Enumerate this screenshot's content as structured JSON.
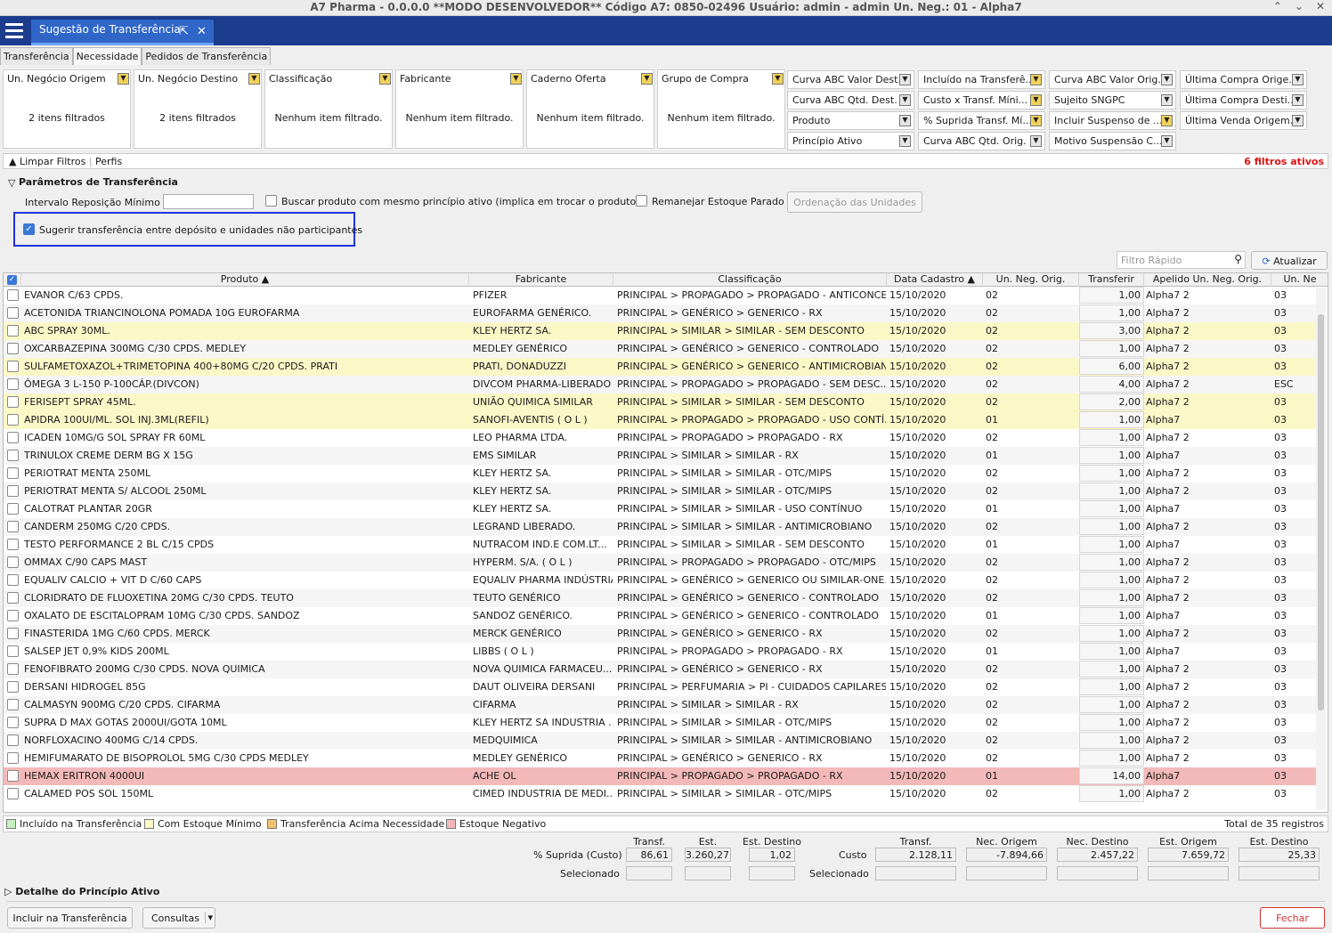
{
  "window": {
    "title": "A7 Pharma - 0.0.0.0   **MODO DESENVOLVEDOR**   Código A7: 0850-02496   Usuário: admin - admin   Un. Neg.: 01 - Alpha7",
    "controls": [
      "⌃",
      "⌄",
      "✕"
    ]
  },
  "tab": {
    "title": "Sugestão de Transferência"
  },
  "subtabs": [
    "Transferência",
    "Necessidade",
    "Pedidos de Transferência"
  ],
  "filters": [
    {
      "label": "Un. Negócio Origem",
      "value": "2 itens filtrados"
    },
    {
      "label": "Un. Negócio Destino",
      "value": "2 itens filtrados"
    },
    {
      "label": "Classificação",
      "value": "Nenhum item filtrado."
    },
    {
      "label": "Fabricante",
      "value": "Nenhum item filtrado."
    },
    {
      "label": "Caderno Oferta",
      "value": "Nenhum item filtrado."
    },
    {
      "label": "Grupo de Compra",
      "value": "Nenhum item filtrado."
    }
  ],
  "filter_cells": [
    [
      "Curva ABC Valor Dest.",
      "Incluído na Transferê...",
      "Curva ABC Valor Orig.",
      "Última Compra Orige..."
    ],
    [
      "Curva ABC Qtd. Dest.",
      "Custo x Transf. Míni...",
      "Sujeito SNGPC",
      "Última Compra Desti..."
    ],
    [
      "Produto",
      "% Suprida Transf. Mí...",
      "Incluir Suspenso de ...",
      "Última Venda Origem..."
    ],
    [
      "Princípio Ativo",
      "Curva ABC Qtd. Orig.",
      "Motivo Suspensão C...",
      ""
    ]
  ],
  "filter_bar": {
    "clear": "Limpar Filtros",
    "profiles": "Perfis",
    "active": "6 filtros ativos"
  },
  "params": {
    "title": "Parâmetros de Transferência",
    "interval_label": "Intervalo Reposição Mínimo",
    "interval_value": "",
    "same_principle": "Buscar produto com mesmo princípio ativo (implica em trocar o produto)",
    "relocate": "Remanejar Estoque Parado",
    "order_button": "Ordenação das Unidades",
    "suggest": "Sugerir transferência entre depósito e unidades não participantes"
  },
  "quick_filter": {
    "placeholder": "Filtro Rápido",
    "refresh": "Atualizar"
  },
  "columns": [
    "Produto ▲",
    "Fabricante",
    "Classificação",
    "Data Cadastro ▲",
    "Un. Neg. Orig.",
    "Transferir",
    "Apelido Un. Neg. Orig.",
    "Un. Ne"
  ],
  "rows": [
    {
      "p": "EVANOR C/63 CPDS.",
      "f": "PFIZER",
      "c": "PRINCIPAL > PROPAGADO > PROPAGADO - ANTICONCE...",
      "d": "15/10/2020",
      "u": "02",
      "t": "1,00",
      "a": "Alpha7 2",
      "n": "03",
      "s": "w"
    },
    {
      "p": "ACETONIDA TRIANCINOLONA POMADA 10G EUROFARMA",
      "f": "EUROFARMA GENÉRICO.",
      "c": "PRINCIPAL > GENÉRICO > GENERICO - RX",
      "d": "15/10/2020",
      "u": "02",
      "t": "1,00",
      "a": "Alpha7 2",
      "n": "03",
      "s": "g"
    },
    {
      "p": "ABC SPRAY 30ML.",
      "f": "KLEY HERTZ SA.",
      "c": "PRINCIPAL > SIMILAR > SIMILAR - SEM DESCONTO",
      "d": "15/10/2020",
      "u": "02",
      "t": "3,00",
      "a": "Alpha7 2",
      "n": "03",
      "s": "y"
    },
    {
      "p": "OXCARBAZEPINA 300MG C/30 CPDS. MEDLEY",
      "f": "MEDLEY GENÉRICO",
      "c": "PRINCIPAL > GENÉRICO > GENERICO - CONTROLADO",
      "d": "15/10/2020",
      "u": "02",
      "t": "1,00",
      "a": "Alpha7 2",
      "n": "03",
      "s": "g"
    },
    {
      "p": "SULFAMETOXAZOL+TRIMETOPINA 400+80MG C/20 CPDS. PRATI",
      "f": "PRATI, DONADUZZI",
      "c": "PRINCIPAL > GENÉRICO > GENERICO - ANTIMICROBIANO",
      "d": "15/10/2020",
      "u": "02",
      "t": "6,00",
      "a": "Alpha7 2",
      "n": "03",
      "s": "y"
    },
    {
      "p": "ÔMEGA 3 L-150 P-100CÁP.(DIVCON)",
      "f": "DIVCOM PHARMA-LIBERADO",
      "c": "PRINCIPAL > PROPAGADO > PROPAGADO - SEM DESC...",
      "d": "15/10/2020",
      "u": "02",
      "t": "4,00",
      "a": "Alpha7 2",
      "n": "ESC",
      "s": "g"
    },
    {
      "p": "FERISEPT SPRAY 45ML.",
      "f": "UNIÃO QUIMICA SIMILAR",
      "c": "PRINCIPAL > SIMILAR > SIMILAR - SEM DESCONTO",
      "d": "15/10/2020",
      "u": "02",
      "t": "2,00",
      "a": "Alpha7 2",
      "n": "03",
      "s": "y"
    },
    {
      "p": "APIDRA 100UI/ML. SOL INJ.3ML(REFIL)",
      "f": "SANOFI-AVENTIS  ( O L )",
      "c": "PRINCIPAL > PROPAGADO > PROPAGADO - USO CONTÍ...",
      "d": "15/10/2020",
      "u": "01",
      "t": "1,00",
      "a": "Alpha7",
      "n": "03",
      "s": "y"
    },
    {
      "p": "ICADEN 10MG/G SOL SPRAY FR 60ML",
      "f": "LEO PHARMA LTDA.",
      "c": "PRINCIPAL > PROPAGADO > PROPAGADO - RX",
      "d": "15/10/2020",
      "u": "02",
      "t": "1,00",
      "a": "Alpha7 2",
      "n": "03",
      "s": "w"
    },
    {
      "p": "TRINULOX CREME DERM BG X 15G",
      "f": "EMS SIMILAR",
      "c": "PRINCIPAL > SIMILAR > SIMILAR - RX",
      "d": "15/10/2020",
      "u": "01",
      "t": "1,00",
      "a": "Alpha7",
      "n": "03",
      "s": "g"
    },
    {
      "p": "PERIOTRAT MENTA 250ML",
      "f": "KLEY HERTZ SA.",
      "c": "PRINCIPAL > SIMILAR > SIMILAR - OTC/MIPS",
      "d": "15/10/2020",
      "u": "02",
      "t": "1,00",
      "a": "Alpha7 2",
      "n": "03",
      "s": "w"
    },
    {
      "p": "PERIOTRAT MENTA S/ ALCOOL 250ML",
      "f": "KLEY HERTZ SA.",
      "c": "PRINCIPAL > SIMILAR > SIMILAR - OTC/MIPS",
      "d": "15/10/2020",
      "u": "02",
      "t": "1,00",
      "a": "Alpha7 2",
      "n": "03",
      "s": "g"
    },
    {
      "p": "CALOTRAT PLANTAR  20GR",
      "f": "KLEY HERTZ SA.",
      "c": "PRINCIPAL > SIMILAR > SIMILAR - USO CONTÍNUO",
      "d": "15/10/2020",
      "u": "01",
      "t": "1,00",
      "a": "Alpha7",
      "n": "03",
      "s": "w"
    },
    {
      "p": "CANDERM 250MG C/20 CPDS.",
      "f": "LEGRAND LIBERADO.",
      "c": "PRINCIPAL > SIMILAR > SIMILAR - ANTIMICROBIANO",
      "d": "15/10/2020",
      "u": "02",
      "t": "1,00",
      "a": "Alpha7 2",
      "n": "03",
      "s": "g"
    },
    {
      "p": "TESTO PERFORMANCE 2 BL C/15 CPDS",
      "f": "NUTRACOM IND.E COM.LT...",
      "c": "PRINCIPAL > SIMILAR > SIMILAR - SEM DESCONTO",
      "d": "15/10/2020",
      "u": "01",
      "t": "1,00",
      "a": "Alpha7",
      "n": "03",
      "s": "w"
    },
    {
      "p": "OMMAX C/90 CAPS MAST",
      "f": "HYPERM. S/A. ( O L )",
      "c": "PRINCIPAL > PROPAGADO > PROPAGADO - OTC/MIPS",
      "d": "15/10/2020",
      "u": "02",
      "t": "1,00",
      "a": "Alpha7 2",
      "n": "03",
      "s": "g"
    },
    {
      "p": "EQUALIV CALCIO + VIT D C/60 CAPS",
      "f": "EQUALIV PHARMA INDÚSTRIA",
      "c": "PRINCIPAL > GENÉRICO > GENERICO OU SIMILAR-ONE...",
      "d": "15/10/2020",
      "u": "02",
      "t": "1,00",
      "a": "Alpha7 2",
      "n": "03",
      "s": "w"
    },
    {
      "p": "CLORIDRATO DE FLUOXETINA 20MG C/30 CPDS. TEUTO",
      "f": "TEUTO GENÉRICO",
      "c": "PRINCIPAL > GENÉRICO > GENERICO - CONTROLADO",
      "d": "15/10/2020",
      "u": "02",
      "t": "1,00",
      "a": "Alpha7 2",
      "n": "03",
      "s": "g"
    },
    {
      "p": "OXALATO DE ESCITALOPRAM 10MG C/30 CPDS. SANDOZ",
      "f": "SANDOZ GENÉRICO.",
      "c": "PRINCIPAL > GENÉRICO > GENERICO - CONTROLADO",
      "d": "15/10/2020",
      "u": "01",
      "t": "1,00",
      "a": "Alpha7",
      "n": "03",
      "s": "w"
    },
    {
      "p": "FINASTERIDA 1MG C/60 CPDS. MERCK",
      "f": "MERCK GENÉRICO",
      "c": "PRINCIPAL > GENÉRICO > GENERICO - RX",
      "d": "15/10/2020",
      "u": "02",
      "t": "1,00",
      "a": "Alpha7 2",
      "n": "03",
      "s": "g"
    },
    {
      "p": "SALSEP JET 0,9% KIDS 200ML",
      "f": "LIBBS (  O L )",
      "c": "PRINCIPAL > PROPAGADO > PROPAGADO - RX",
      "d": "15/10/2020",
      "u": "01",
      "t": "1,00",
      "a": "Alpha7",
      "n": "03",
      "s": "w"
    },
    {
      "p": "FENOFIBRATO 200MG C/30 CPDS. NOVA QUIMICA",
      "f": "NOVA QUIMICA FARMACEU...",
      "c": "PRINCIPAL > GENÉRICO > GENERICO - RX",
      "d": "15/10/2020",
      "u": "02",
      "t": "1,00",
      "a": "Alpha7 2",
      "n": "03",
      "s": "g"
    },
    {
      "p": "DERSANI HIDROGEL 85G",
      "f": "DAUT OLIVEIRA DERSANI",
      "c": "PRINCIPAL > PERFUMARIA > PI - CUIDADOS CAPILARES",
      "d": "15/10/2020",
      "u": "02",
      "t": "1,00",
      "a": "Alpha7 2",
      "n": "03",
      "s": "w"
    },
    {
      "p": "CALMASYN 900MG C/20 CPDS. CIFARMA",
      "f": "CIFARMA",
      "c": "PRINCIPAL > SIMILAR > SIMILAR - RX",
      "d": "15/10/2020",
      "u": "02",
      "t": "1,00",
      "a": "Alpha7 2",
      "n": "03",
      "s": "g"
    },
    {
      "p": "SUPRA D MAX GOTAS 2000UI/GOTA 10ML",
      "f": "KLEY HERTZ SA INDUSTRIA ...",
      "c": "PRINCIPAL > SIMILAR > SIMILAR - OTC/MIPS",
      "d": "15/10/2020",
      "u": "02",
      "t": "1,00",
      "a": "Alpha7 2",
      "n": "03",
      "s": "w"
    },
    {
      "p": "NORFLOXACINO 400MG C/14 CPDS.",
      "f": "MEDQUIMICA",
      "c": "PRINCIPAL > SIMILAR > SIMILAR - ANTIMICROBIANO",
      "d": "15/10/2020",
      "u": "02",
      "t": "1,00",
      "a": "Alpha7 2",
      "n": "03",
      "s": "g"
    },
    {
      "p": "HEMIFUMARATO DE BISOPROLOL 5MG C/30 CPDS  MEDLEY",
      "f": "MEDLEY GENÉRICO",
      "c": "PRINCIPAL > GENÉRICO > GENERICO - RX",
      "d": "15/10/2020",
      "u": "02",
      "t": "1,00",
      "a": "Alpha7 2",
      "n": "03",
      "s": "w"
    },
    {
      "p": "HEMAX ERITRON 4000UI",
      "f": "ACHE OL",
      "c": "PRINCIPAL > PROPAGADO > PROPAGADO - RX",
      "d": "15/10/2020",
      "u": "01",
      "t": "14,00",
      "a": "Alpha7",
      "n": "03",
      "s": "r"
    },
    {
      "p": "CALAMED POS SOL 150ML",
      "f": "CIMED INDUSTRIA DE MEDI...",
      "c": "PRINCIPAL > SIMILAR > SIMILAR - OTC/MIPS",
      "d": "15/10/2020",
      "u": "02",
      "t": "1,00",
      "a": "Alpha7 2",
      "n": "03",
      "s": "w"
    }
  ],
  "legend": [
    {
      "label": "Incluído na Transferência",
      "color": "#c9f0c0"
    },
    {
      "label": "Com Estoque Mínimo",
      "color": "#fbf8c8"
    },
    {
      "label": "Transferência Acima Necessidade",
      "color": "#f5c070"
    },
    {
      "label": "Estoque Negativo",
      "color": "#f3b8b8"
    }
  ],
  "total": "Total de 35 registros",
  "summary": {
    "h1": [
      "Transf.",
      "Est. Origem",
      "Est. Destino"
    ],
    "h2": [
      "Transf.",
      "Nec. Origem",
      "Nec. Destino",
      "Est. Origem",
      "Est. Destino"
    ],
    "pct_label": "% Suprida (Custo)",
    "sel_label": "Selecionado",
    "cost_label": "Custo",
    "pct": [
      "86,61",
      "3.260,27",
      "1,02"
    ],
    "cost": [
      "2.128,11",
      "-7.894,66",
      "2.457,22",
      "7.659,72",
      "25,33"
    ]
  },
  "detail": "Detalhe do Princípio Ativo",
  "buttons": {
    "include": "Incluir na Transferência",
    "queries": "Consultas",
    "close": "Fechar"
  }
}
